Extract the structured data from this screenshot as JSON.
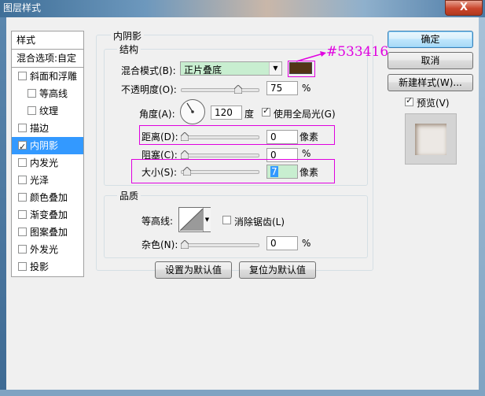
{
  "window": {
    "title": "图层样式",
    "close": "X"
  },
  "style_list": {
    "header": "样式",
    "blend_options": "混合选项:自定",
    "items": [
      {
        "label": "斜面和浮雕",
        "checked": false
      },
      {
        "label": "等高线",
        "checked": false
      },
      {
        "label": "纹理",
        "checked": false
      },
      {
        "label": "描边",
        "checked": false
      },
      {
        "label": "内阴影",
        "checked": true
      },
      {
        "label": "内发光",
        "checked": false
      },
      {
        "label": "光泽",
        "checked": false
      },
      {
        "label": "颜色叠加",
        "checked": false
      },
      {
        "label": "渐变叠加",
        "checked": false
      },
      {
        "label": "图案叠加",
        "checked": false
      },
      {
        "label": "外发光",
        "checked": false
      },
      {
        "label": "投影",
        "checked": false
      }
    ]
  },
  "inner_shadow": {
    "section_title": "内阴影",
    "structure": {
      "title": "结构",
      "blend_mode_label": "混合模式(B):",
      "blend_mode_value": "正片叠底",
      "color": "#533416",
      "color_annotation": "#533416",
      "opacity_label": "不透明度(O):",
      "opacity_value": "75",
      "opacity_unit": "%",
      "opacity_fraction": 0.75,
      "angle_label": "角度(A):",
      "angle_value": "120",
      "angle_unit": "度",
      "global_light_label": "使用全局光(G)",
      "global_light_checked": true,
      "distance_label": "距离(D):",
      "distance_value": "0",
      "distance_unit": "像素",
      "choke_label": "阻塞(C):",
      "choke_value": "0",
      "choke_unit": "%",
      "size_label": "大小(S):",
      "size_value": "7",
      "size_unit": "像素"
    },
    "quality": {
      "title": "品质",
      "contour_label": "等高线:",
      "antialias_label": "消除锯齿(L)",
      "antialias_checked": false,
      "noise_label": "杂色(N):",
      "noise_value": "0",
      "noise_unit": "%"
    },
    "make_default": "设置为默认值",
    "reset_default": "复位为默认值"
  },
  "buttons": {
    "ok": "确定",
    "cancel": "取消",
    "new_style": "新建样式(W)...",
    "preview_label": "预览(V)",
    "preview_checked": true
  }
}
